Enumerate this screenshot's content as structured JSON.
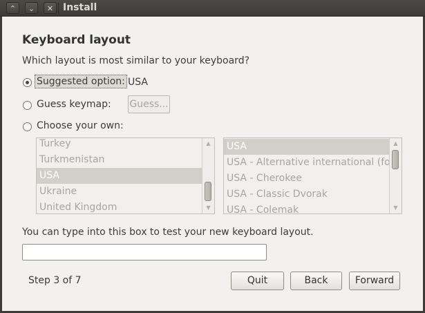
{
  "window": {
    "title": "Install",
    "controls": {
      "minimize_symbol": "⌃",
      "maximize_symbol": "⌄",
      "close_symbol": "✕"
    }
  },
  "page": {
    "heading": "Keyboard layout",
    "question": "Which layout is most similar to your keyboard?"
  },
  "options": {
    "suggested": {
      "label": "Suggested option:",
      "value": "USA",
      "checked": true
    },
    "guess": {
      "label": "Guess keymap:",
      "button_label": "Guess..."
    },
    "choose": {
      "label": "Choose your own:"
    }
  },
  "layout_list": {
    "items": [
      "Turkey",
      "Turkmenistan",
      "USA",
      "Ukraine",
      "United Kingdom"
    ],
    "selected": "USA"
  },
  "variant_list": {
    "items": [
      "USA",
      "USA - Alternative international (former us_intl)",
      "USA - Cherokee",
      "USA - Classic Dvorak",
      "USA - Colemak"
    ],
    "selected": "USA"
  },
  "test": {
    "label": "You can type into this box to test your new keyboard layout.",
    "value": "",
    "placeholder": ""
  },
  "footer": {
    "step": "Step 3 of 7",
    "quit_label": "Quit",
    "back_label": "Back",
    "forward_label": "Forward"
  }
}
